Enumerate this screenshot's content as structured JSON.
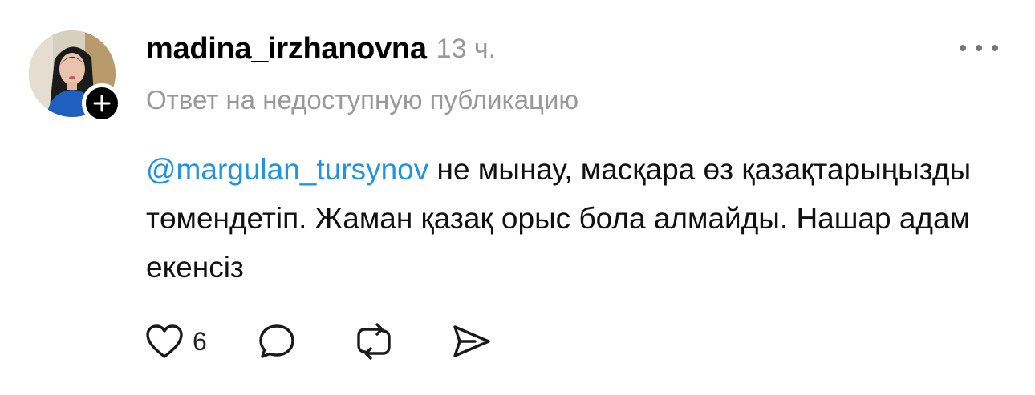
{
  "post": {
    "username": "madina_irzhanovna",
    "timestamp": "13 ч.",
    "reply_context": "Ответ на недоступную публикацию",
    "mention": "@margulan_tursynov",
    "text": " не мынау, масқара өз қазақтарыңызды төмендетіп. Жаман қазақ орыс бола алмайды. Нашар адам екенсіз",
    "like_count": "6"
  },
  "icons": {
    "follow": "plus-icon",
    "more": "more-horizontal-icon",
    "like": "heart-icon",
    "comment": "comment-icon",
    "repost": "repost-icon",
    "share": "send-icon"
  },
  "colors": {
    "mention": "#1f93e6",
    "secondary_text": "#999999",
    "primary_text": "#111111",
    "badge": "#000000"
  }
}
